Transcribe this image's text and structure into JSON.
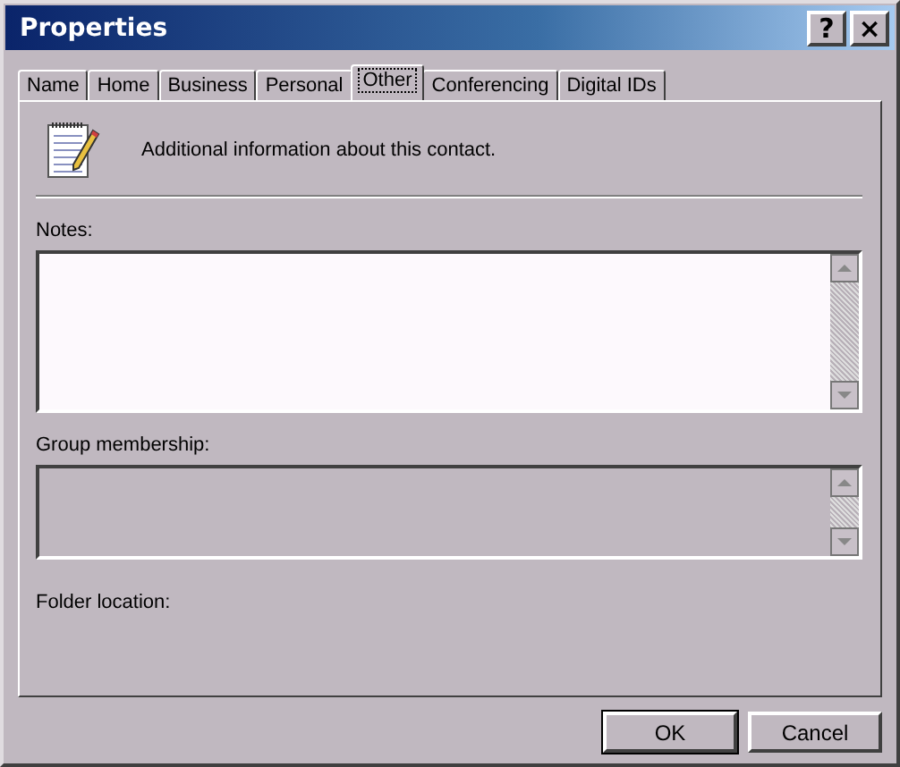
{
  "window": {
    "title": "Properties",
    "title_buttons": [
      "?",
      "×"
    ]
  },
  "tabs": [
    {
      "label": "Name",
      "selected": false
    },
    {
      "label": "Home",
      "selected": false
    },
    {
      "label": "Business",
      "selected": false
    },
    {
      "label": "Personal",
      "selected": false
    },
    {
      "label": "Other",
      "selected": true
    },
    {
      "label": "Conferencing",
      "selected": false
    },
    {
      "label": "Digital IDs",
      "selected": false
    }
  ],
  "header": {
    "text": "Additional information about this contact."
  },
  "fields": [
    {
      "label": "Notes:",
      "disabled": false
    },
    {
      "label": "Group membership:",
      "disabled": true
    }
  ],
  "folder_location": {
    "label": "Folder location:"
  },
  "buttons": [
    {
      "label": "OK",
      "default": true
    },
    {
      "label": "Cancel",
      "default": false
    }
  ]
}
